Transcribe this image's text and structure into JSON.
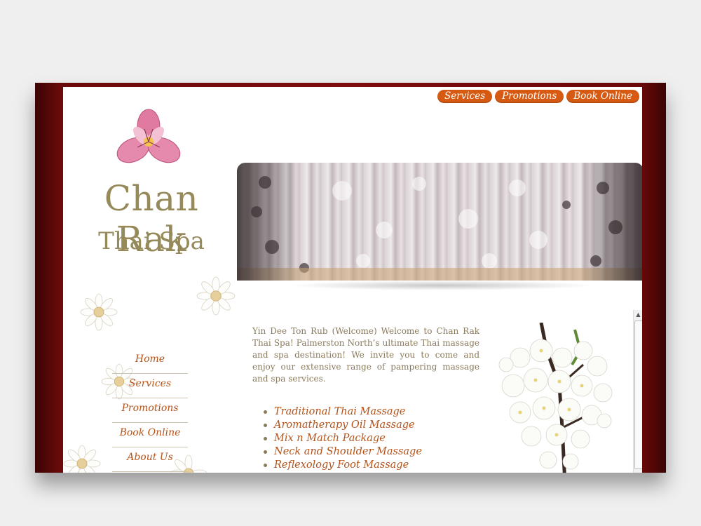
{
  "site": {
    "title_main": "Chan Rak",
    "title_sub": "Thai Spa"
  },
  "topnav": [
    {
      "label": "Services"
    },
    {
      "label": "Promotions"
    },
    {
      "label": "Book Online"
    }
  ],
  "sidenav": [
    {
      "label": "Home"
    },
    {
      "label": "Services"
    },
    {
      "label": "Promotions"
    },
    {
      "label": "Book Online"
    },
    {
      "label": "About Us"
    }
  ],
  "content": {
    "intro": "Yin Dee Ton Rub (Welcome) Welcome to Chan Rak Thai Spa! Palmerston North’s ultimate Thai massage and spa destination! We invite you to come and enjoy our extensive range of pampering massage and spa services.",
    "services": [
      "Traditional Thai Massage",
      "Aromatherapy Oil Massage",
      "Mix n Match Package",
      "Neck and Shoulder Massage",
      "Reflexology Foot Massage"
    ]
  },
  "colors": {
    "frame": "#7e0c0c",
    "nav_button": "#d65a12",
    "title_text": "#968a5b",
    "link_text": "#b55319",
    "body_text": "#8a7a5c"
  },
  "icons": {
    "logo": "pink-lily-flower-icon",
    "decor": "white-daisy-icon",
    "photo_side": "white-cherry-blossom-image",
    "banner": "curtain-photo"
  }
}
